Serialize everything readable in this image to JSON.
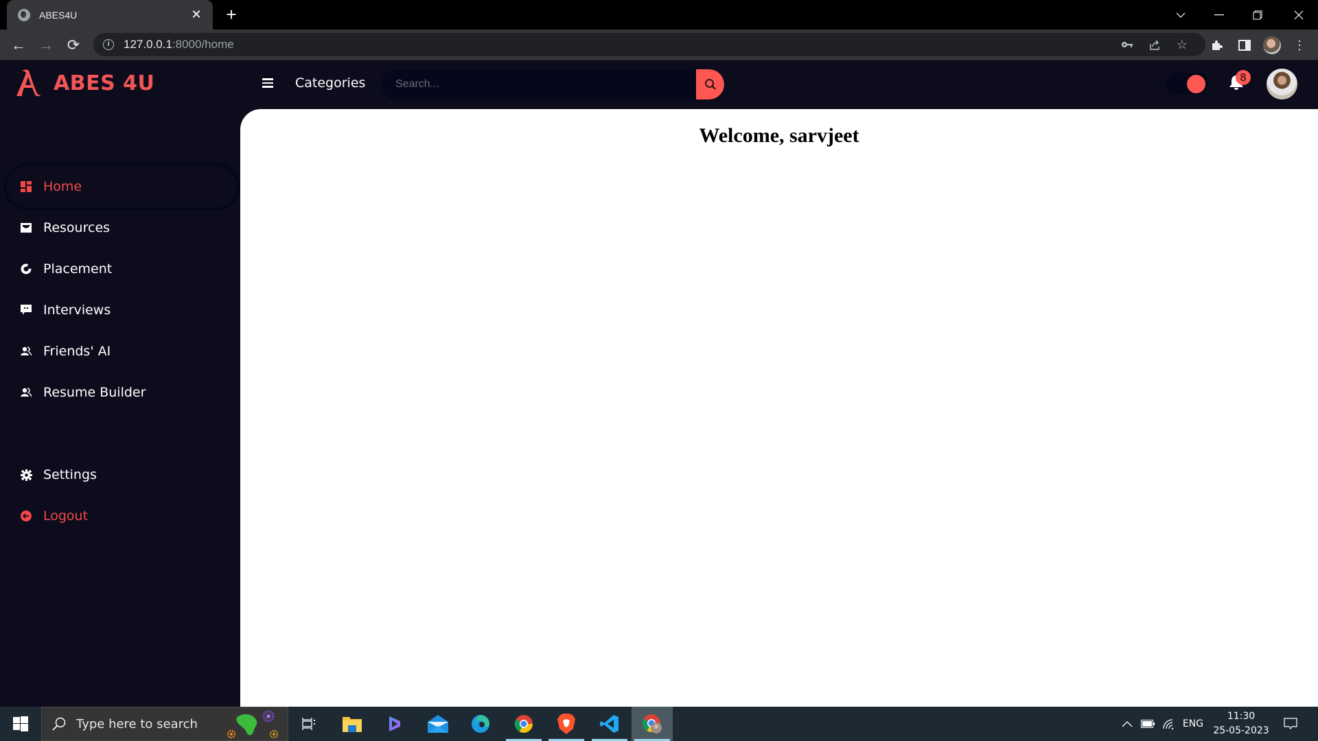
{
  "browser": {
    "tab_title": "ABES4U",
    "url_host": "127.0.0.1",
    "url_path": ":8000/home",
    "notification_badge_color": "#ff5752"
  },
  "app": {
    "brand_name": "ABES 4U",
    "brand_color": "#f25555",
    "accent_color": "#ff5752",
    "categories_label": "Categories",
    "search": {
      "placeholder": "Search...",
      "value": ""
    },
    "theme_toggle": {
      "state": "on"
    },
    "notifications": {
      "count": "8"
    },
    "sidebar": {
      "items": [
        {
          "label": "Home",
          "icon": "dashboard-icon",
          "active": true
        },
        {
          "label": "Resources",
          "icon": "inbox-icon",
          "active": false
        },
        {
          "label": "Placement",
          "icon": "pie-chart-icon",
          "active": false
        },
        {
          "label": "Interviews",
          "icon": "chat-icon",
          "active": false
        },
        {
          "label": "Friends' AI",
          "icon": "users-icon",
          "active": false
        },
        {
          "label": "Resume Builder",
          "icon": "users-icon",
          "active": false
        }
      ],
      "bottom_items": [
        {
          "label": "Settings",
          "icon": "gear-icon"
        },
        {
          "label": "Logout",
          "icon": "logout-icon"
        }
      ]
    },
    "main": {
      "heading": "Welcome, sarvjeet"
    }
  },
  "taskbar": {
    "search_placeholder": "Type here to search",
    "apps": [
      "Task View",
      "File Explorer",
      "Copilot",
      "Mail",
      "Microsoft Edge",
      "Google Chrome",
      "Brave",
      "Visual Studio Code",
      "Google Chrome (profile)"
    ],
    "tray": {
      "language": "ENG",
      "time": "11:30",
      "date": "25-05-2023"
    }
  }
}
